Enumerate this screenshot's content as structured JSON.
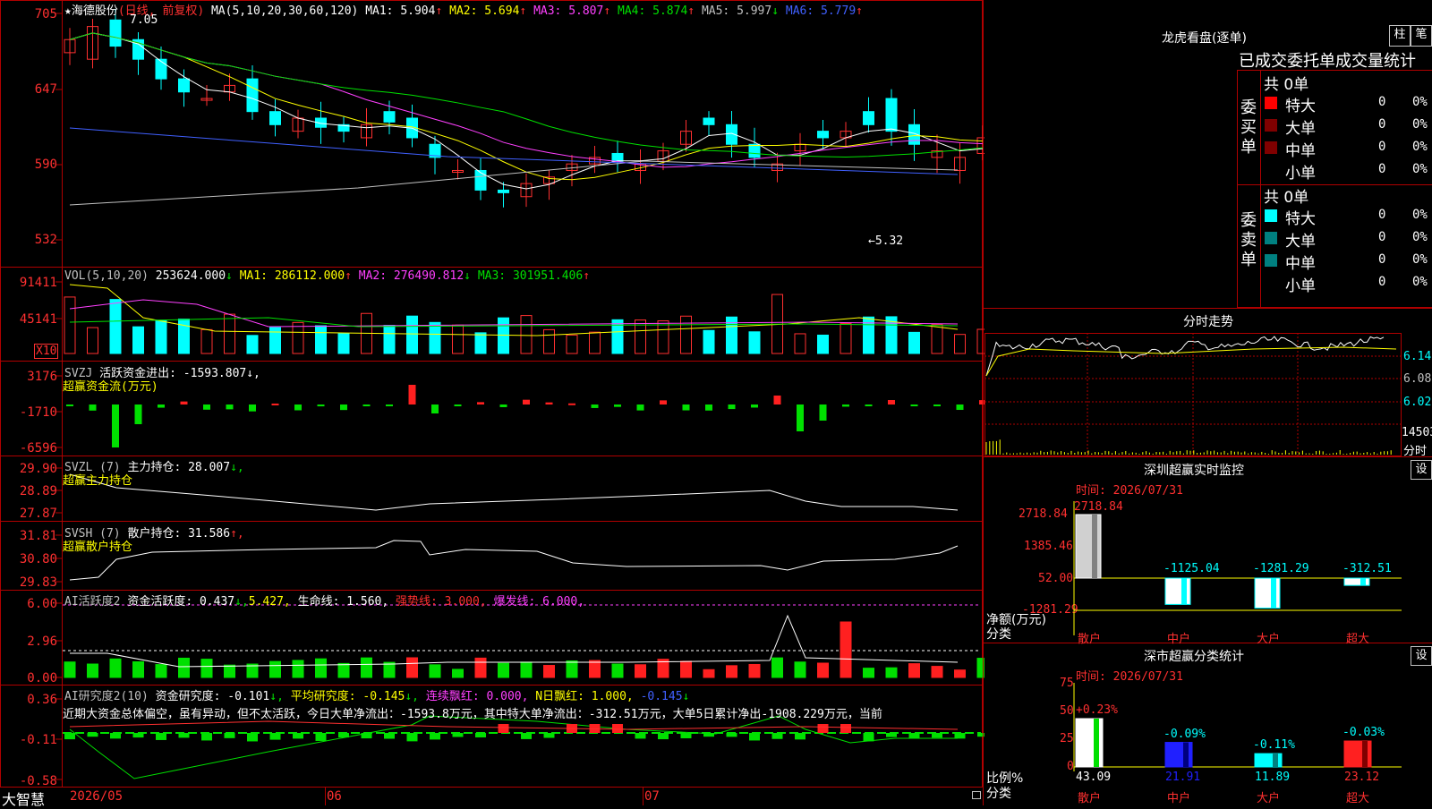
{
  "stock": {
    "name": "海德股份",
    "star": "★",
    "period": "(日线, 前复权)"
  },
  "kline": {
    "ma_label": "MA(5,10,20,30,60,120)",
    "ma": [
      {
        "label": "MA1: 5.904",
        "arrow": "↑",
        "color": "#ffffff"
      },
      {
        "label": "MA2: 5.694",
        "arrow": "↑",
        "color": "#ffff00"
      },
      {
        "label": "MA3: 5.807",
        "arrow": "↑",
        "color": "#ff40ff"
      },
      {
        "label": "MA4: 5.874",
        "arrow": "↑",
        "color": "#00e000"
      },
      {
        "label": "MA5: 5.997",
        "arrow": "↓",
        "color": "#c0c0c0"
      },
      {
        "label": "MA6: 5.779",
        "arrow": "↑",
        "color": "#4060ff"
      }
    ],
    "yticks": [
      "705",
      "647",
      "590",
      "532"
    ],
    "high_label": "7.05",
    "low_label": "←5.32"
  },
  "vol": {
    "title": "VOL(5,10,20)",
    "value": "253624.000",
    "arrow": "↓",
    "ma": [
      {
        "label": "MA1: 286112.000",
        "arrow": "↑",
        "color": "#ffff00"
      },
      {
        "label": "MA2: 276490.812",
        "arrow": "↓",
        "color": "#ff40ff"
      },
      {
        "label": "MA3: 301951.406",
        "arrow": "↑",
        "color": "#00e000"
      }
    ],
    "yticks": [
      "91411",
      "45141"
    ],
    "unit": "X10"
  },
  "svzj": {
    "title": "SVZJ",
    "desc": "活跃资金进出: -1593.807",
    "arrow": "↓,",
    "sub": "超赢资金流(万元)",
    "yticks": [
      "3176",
      "-1710",
      "-6596"
    ]
  },
  "svzl": {
    "title": "SVZL (7)",
    "desc": "主力持仓: 28.007",
    "arrow": "↓,",
    "sub": "超赢主力持仓",
    "yticks": [
      "29.90",
      "28.89",
      "27.87"
    ]
  },
  "svsh": {
    "title": "SVSH (7)",
    "desc": "散户持仓: 31.586",
    "arrow": "↑,",
    "sub": "超赢散户持仓",
    "yticks": [
      "31.81",
      "30.80",
      "29.83"
    ]
  },
  "ai1": {
    "title": "AI活跃度2",
    "desc": "资金活跃度: 0.437",
    "arrow": "↓,",
    "v2": "5.427,",
    "v3": "生命线: 1.560,",
    "v4": "强势线: 3.000,",
    "v5": "爆发线: 6.000,",
    "yticks": [
      "6.00",
      "2.96",
      "0.00"
    ]
  },
  "ai2": {
    "title": "AI研究度2(10)",
    "desc": "资金研究度: -0.101",
    "arrow": "↓,",
    "v2": "平均研究度: -0.145",
    "v2a": "↓,",
    "v3": "连续飘红: 0.000,",
    "v4": "N日飘红: 1.000,",
    "v5": "-0.145",
    "v5a": "↓",
    "comment": "近期大资金总体偏空，虽有异动，但不太活跃，今日大单净流出：-1593.8万元，其中特大单净流出：-312.51万元，大单5日累计净出-1908.229万元，当前",
    "yticks": [
      "0.36",
      "-0.11",
      "-0.58"
    ]
  },
  "xaxis": {
    "brand": "大智慧",
    "labels": [
      "2026/05",
      "06",
      "07"
    ]
  },
  "lhb": {
    "title": "龙虎看盘(逐单)",
    "btn1": "柱",
    "btn2": "笔",
    "header": "已成交委托单成交量统计",
    "buy": {
      "label": "委买单",
      "total": "共 0单",
      "rows": [
        {
          "name": "特大",
          "val": "0",
          "pct": "0%",
          "color": "#ff0000"
        },
        {
          "name": "大单",
          "val": "0",
          "pct": "0%",
          "color": "#800000"
        },
        {
          "name": "中单",
          "val": "0",
          "pct": "0%",
          "color": "#800000"
        },
        {
          "name": "小单",
          "val": "0",
          "pct": "0%",
          "color": ""
        }
      ]
    },
    "sell": {
      "label": "委卖单",
      "total": "共 0单",
      "rows": [
        {
          "name": "特大",
          "val": "0",
          "pct": "0%",
          "color": "#00ffff"
        },
        {
          "name": "大单",
          "val": "0",
          "pct": "0%",
          "color": "#008080"
        },
        {
          "name": "中单",
          "val": "0",
          "pct": "0%",
          "color": "#008080"
        },
        {
          "name": "小单",
          "val": "0",
          "pct": "0%",
          "color": ""
        }
      ]
    }
  },
  "fenshi": {
    "title": "分时走势",
    "yticks": [
      "6.14",
      "6.08",
      "6.02"
    ],
    "vol": "14503",
    "unit": "分时"
  },
  "monitor": {
    "title": "深圳超赢实时监控",
    "btn": "设",
    "time": "时间: 2026/07/31",
    "yticks": [
      "2718.84",
      "1385.46",
      "52.00",
      "-1281.29"
    ],
    "ylab1": "净额(万元)",
    "ylab2": "分类",
    "bars": [
      {
        "cat": "散户",
        "value": 2718.84,
        "label": "2718.84"
      },
      {
        "cat": "中户",
        "value": -1125.04,
        "label": "-1125.04"
      },
      {
        "cat": "大户",
        "value": -1281.29,
        "label": "-1281.29"
      },
      {
        "cat": "超大",
        "value": -312.51,
        "label": "-312.51"
      }
    ]
  },
  "classify": {
    "title": "深市超赢分类统计",
    "btn": "设",
    "time": "时间: 2026/07/31",
    "yticks": [
      "75",
      "50",
      "25",
      "0"
    ],
    "ylab1": "比例%",
    "ylab2": "分类",
    "bars": [
      {
        "cat": "散户",
        "value": 43.09,
        "label": "43.09",
        "chg": "+0.23%",
        "color": "#ffffff",
        "chgcolor": "#ff3030"
      },
      {
        "cat": "中户",
        "value": 21.91,
        "label": "21.91",
        "chg": "-0.09%",
        "color": "#2020ff",
        "chgcolor": "#00ffff"
      },
      {
        "cat": "大户",
        "value": 11.89,
        "label": "11.89",
        "chg": "-0.11%",
        "color": "#00ffff",
        "chgcolor": "#00ffff"
      },
      {
        "cat": "超大",
        "value": 23.12,
        "label": "23.12",
        "chg": "-0.03%",
        "color": "#ff2020",
        "chgcolor": "#00ffff"
      }
    ]
  }
}
